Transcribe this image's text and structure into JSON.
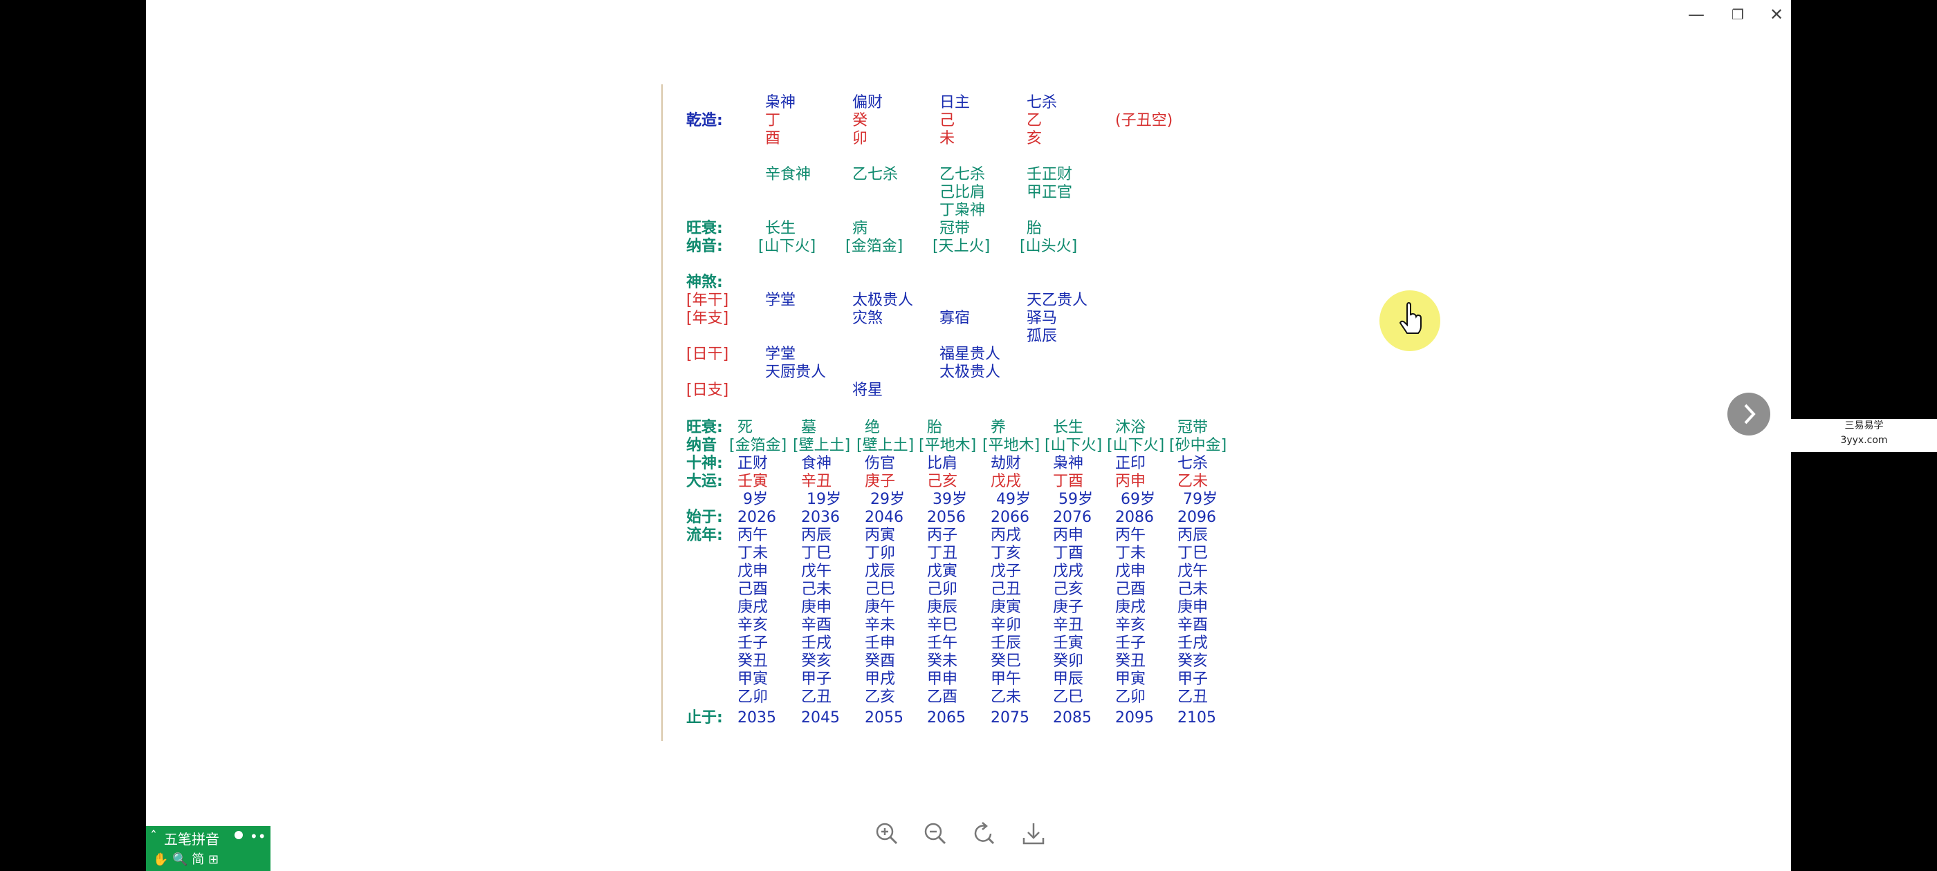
{
  "window_controls": {
    "minimize": "—",
    "restore": "❐",
    "close": "✕"
  },
  "chart": {
    "gender_label": "乾造:",
    "ten_gods_top": [
      "枭神",
      "偏财",
      "日主",
      "七杀"
    ],
    "stems": [
      "丁",
      "癸",
      "己",
      "乙"
    ],
    "branches": [
      "酉",
      "卯",
      "未",
      "亥"
    ],
    "empty_note": "(子丑空)",
    "hidden": [
      [
        "辛食神"
      ],
      [
        "乙七杀"
      ],
      [
        "乙七杀",
        "己比肩",
        "丁枭神"
      ],
      [
        "壬正财",
        "甲正官"
      ]
    ],
    "wangshuai_label": "旺衰:",
    "wangshuai": [
      "长生",
      "病",
      "冠带",
      "胎"
    ],
    "nayin_label": "纳音:",
    "nayin": [
      "[山下火]",
      "[金箔金]",
      "[天上火]",
      "[山头火]"
    ]
  },
  "shensha": {
    "title": "神煞:",
    "rows": [
      {
        "label": "[年干]",
        "cells": [
          [
            "学堂"
          ],
          [
            "太极贵人"
          ],
          [],
          [
            "天乙贵人"
          ]
        ]
      },
      {
        "label": "[年支]",
        "cells": [
          [],
          [
            "灾煞"
          ],
          [
            "寡宿"
          ],
          [
            "驿马",
            "孤辰"
          ]
        ]
      },
      {
        "label": "[日干]",
        "cells": [
          [
            "学堂",
            "天厨贵人"
          ],
          [],
          [
            "福星贵人",
            "太极贵人"
          ],
          []
        ]
      },
      {
        "label": "[日支]",
        "cells": [
          [],
          [
            "将星"
          ],
          [],
          []
        ]
      }
    ]
  },
  "dayun": {
    "wangshuai_label": "旺衰:",
    "wangshuai": [
      "死",
      "墓",
      "绝",
      "胎",
      "养",
      "长生",
      "沐浴",
      "冠带"
    ],
    "nayin_label": "纳音",
    "nayin": [
      "[金箔金]",
      "[壁上土]",
      "[壁上土]",
      "[平地木]",
      "[平地木]",
      "[山下火]",
      "[山下火]",
      "[砂中金]"
    ],
    "shishen_label": "十神:",
    "shishen": [
      "正财",
      "食神",
      "伤官",
      "比肩",
      "劫财",
      "枭神",
      "正印",
      "七杀"
    ],
    "dayun_label": "大运:",
    "ganzhi": [
      "壬寅",
      "辛丑",
      "庚子",
      "己亥",
      "戊戌",
      "丁酉",
      "丙申",
      "乙未"
    ],
    "ages": [
      "9岁",
      "19岁",
      "29岁",
      "39岁",
      "49岁",
      "59岁",
      "69岁",
      "79岁"
    ],
    "start_label": "始于:",
    "start_years": [
      "2026",
      "2036",
      "2046",
      "2056",
      "2066",
      "2076",
      "2086",
      "2096"
    ],
    "liunian_label": "流年:",
    "liunian": [
      [
        "丙午",
        "丁未",
        "戊申",
        "己酉",
        "庚戌",
        "辛亥",
        "壬子",
        "癸丑",
        "甲寅",
        "乙卯"
      ],
      [
        "丙辰",
        "丁巳",
        "戊午",
        "己未",
        "庚申",
        "辛酉",
        "壬戌",
        "癸亥",
        "甲子",
        "乙丑"
      ],
      [
        "丙寅",
        "丁卯",
        "戊辰",
        "己巳",
        "庚午",
        "辛未",
        "壬申",
        "癸酉",
        "甲戌",
        "乙亥"
      ],
      [
        "丙子",
        "丁丑",
        "戊寅",
        "己卯",
        "庚辰",
        "辛巳",
        "壬午",
        "癸未",
        "甲申",
        "乙酉"
      ],
      [
        "丙戌",
        "丁亥",
        "戊子",
        "己丑",
        "庚寅",
        "辛卯",
        "壬辰",
        "癸巳",
        "甲午",
        "乙未"
      ],
      [
        "丙申",
        "丁酉",
        "戊戌",
        "己亥",
        "庚子",
        "辛丑",
        "壬寅",
        "癸卯",
        "甲辰",
        "乙巳"
      ],
      [
        "丙午",
        "丁未",
        "戊申",
        "己酉",
        "庚戌",
        "辛亥",
        "壬子",
        "癸丑",
        "甲寅",
        "乙卯"
      ],
      [
        "丙辰",
        "丁巳",
        "戊午",
        "己未",
        "庚申",
        "辛酉",
        "壬戌",
        "癸亥",
        "甲子",
        "乙丑"
      ]
    ],
    "end_label": "止于:",
    "end_years": [
      "2035",
      "2045",
      "2055",
      "2065",
      "2075",
      "2085",
      "2095",
      "2105"
    ]
  },
  "watermark": {
    "line1": "三易易学",
    "line2": "3yyx.com"
  },
  "ime": {
    "label": "五笔拼音",
    "row2": "✋ 🔍 简 ⊞"
  },
  "colors": {
    "blue": "#1a2db0",
    "red": "#d63030",
    "green": "#0f8a6e",
    "ime": "#129b4a"
  },
  "icons": [
    "zoom-in-icon",
    "zoom-out-icon",
    "rotate-icon",
    "download-icon",
    "chevron-right-icon",
    "minimize-icon",
    "restore-icon",
    "close-icon",
    "hand-cursor-icon"
  ]
}
